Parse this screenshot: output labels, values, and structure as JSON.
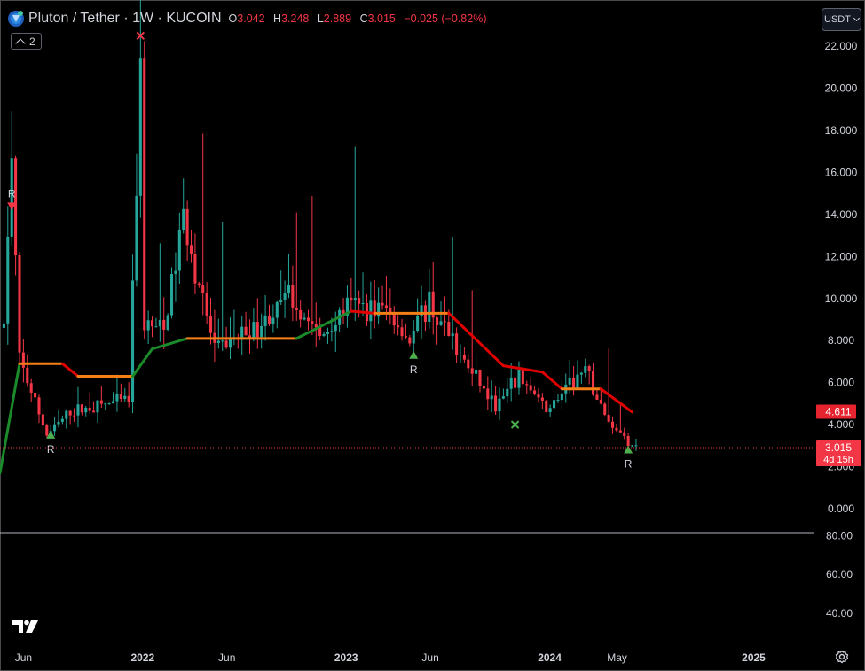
{
  "header": {
    "symbol_title": "Pluton / Tether · 1W · KUCOIN",
    "ohlc": [
      {
        "key": "O",
        "value": "3.042"
      },
      {
        "key": "H",
        "value": "3.248"
      },
      {
        "key": "L",
        "value": "2.889"
      },
      {
        "key": "C",
        "value": "3.015"
      }
    ],
    "change": "−0.025 (−0.82%)",
    "indicator_count": "2"
  },
  "currency_button": "USDT",
  "price_tags": {
    "indicator_value": "4.611",
    "last_price": "3.015",
    "countdown": "4d 15h"
  },
  "colors": {
    "up": "#26a69a",
    "down": "#f23645",
    "trend_green": "#1b8a2a",
    "trend_orange": "#f57f17",
    "trend_red": "#e00000",
    "signal_green": "#4caf50"
  },
  "chart_data": [
    {
      "type": "candlestick",
      "title": "Pluton / Tether · 1W · KUCOIN",
      "x_tick_labels": [
        "Jun",
        "2022",
        "Jun",
        "2023",
        "Jun",
        "2024",
        "May",
        "2025"
      ],
      "y_tick_labels": [
        "0.000",
        "2.000",
        "4.000",
        "6.000",
        "8.000",
        "10.000",
        "12.000",
        "14.000",
        "16.000",
        "18.000",
        "20.000",
        "22.000"
      ],
      "ylim": [
        -1.1,
        24.2
      ],
      "xlim": [
        "2021-04-20",
        "2025-04-20"
      ],
      "last_close": 3.015,
      "series": [
        {
          "name": "Price",
          "points": [
            {
              "x": "2021-04-27",
              "close": 8.6
            },
            {
              "x": "2021-05-04",
              "close": 13.2
            },
            {
              "x": "2021-05-11",
              "close": 16.4
            },
            {
              "x": "2021-05-25",
              "close": 7.1
            },
            {
              "x": "2021-07-13",
              "close": 3.5
            },
            {
              "x": "2021-08-24",
              "close": 4.6
            },
            {
              "x": "2021-10-12",
              "close": 4.9
            },
            {
              "x": "2021-12-07",
              "close": 5.2
            },
            {
              "x": "2021-12-28",
              "close": 20.8
            },
            {
              "x": "2022-01-04",
              "close": 8.8
            },
            {
              "x": "2022-02-08",
              "close": 8.4
            },
            {
              "x": "2022-03-15",
              "close": 13.9
            },
            {
              "x": "2022-05-10",
              "close": 7.5
            },
            {
              "x": "2022-08-09",
              "close": 8.9
            },
            {
              "x": "2022-09-20",
              "close": 10.1
            },
            {
              "x": "2022-11-15",
              "close": 8.1
            },
            {
              "x": "2023-01-03",
              "close": 9.6
            },
            {
              "x": "2023-03-14",
              "close": 9.5
            },
            {
              "x": "2023-04-25",
              "close": 8.0
            },
            {
              "x": "2023-05-30",
              "close": 10.0
            },
            {
              "x": "2023-06-13",
              "close": 9.0
            },
            {
              "x": "2023-07-25",
              "close": 7.3
            },
            {
              "x": "2023-09-26",
              "close": 4.8
            },
            {
              "x": "2023-11-07",
              "close": 6.3
            },
            {
              "x": "2023-12-26",
              "close": 4.7
            },
            {
              "x": "2024-03-05",
              "close": 6.6
            },
            {
              "x": "2024-04-09",
              "close": 4.4
            },
            {
              "x": "2024-05-21",
              "close": 3.2
            },
            {
              "x": "2024-06-04",
              "close": 3.0
            }
          ]
        },
        {
          "name": "Trend line",
          "points": [
            {
              "x": "2021-04-20",
              "y": 1.7
            },
            {
              "x": "2021-05-25",
              "y": 6.9
            },
            {
              "x": "2021-08-10",
              "y": 6.9
            },
            {
              "x": "2021-09-07",
              "y": 6.3
            },
            {
              "x": "2021-12-14",
              "y": 6.3
            },
            {
              "x": "2022-01-18",
              "y": 7.6
            },
            {
              "x": "2022-03-22",
              "y": 8.1
            },
            {
              "x": "2022-10-04",
              "y": 8.1
            },
            {
              "x": "2023-01-10",
              "y": 9.4
            },
            {
              "x": "2023-02-21",
              "y": 9.3
            },
            {
              "x": "2023-05-30",
              "y": 9.3
            },
            {
              "x": "2023-07-04",
              "y": 9.3
            },
            {
              "x": "2023-10-10",
              "y": 6.8
            },
            {
              "x": "2023-12-19",
              "y": 6.5
            },
            {
              "x": "2024-01-23",
              "y": 5.7
            },
            {
              "x": "2024-04-02",
              "y": 5.7
            },
            {
              "x": "2024-05-28",
              "y": 4.6
            }
          ]
        }
      ],
      "markers": [
        {
          "x": "2021-05-11",
          "y": 14.4,
          "kind": "triangle-down",
          "label": "R",
          "color": "#f23645"
        },
        {
          "x": "2021-07-20",
          "y": 3.5,
          "kind": "triangle-up",
          "label": "R",
          "color": "#4caf50"
        },
        {
          "x": "2021-12-28",
          "y": 22.5,
          "kind": "cross",
          "label": "",
          "color": "#f23645"
        },
        {
          "x": "2023-05-02",
          "y": 7.3,
          "kind": "triangle-up",
          "label": "R",
          "color": "#4caf50"
        },
        {
          "x": "2023-10-31",
          "y": 4.0,
          "kind": "cross",
          "label": "",
          "color": "#4caf50"
        },
        {
          "x": "2024-05-21",
          "y": 2.8,
          "kind": "triangle-up",
          "label": "R",
          "color": "#4caf50"
        }
      ]
    },
    {
      "type": "line",
      "title": "",
      "y_tick_labels": [
        "40.00",
        "60.00",
        "80.00"
      ],
      "ylim": [
        28,
        82
      ],
      "series": []
    }
  ]
}
